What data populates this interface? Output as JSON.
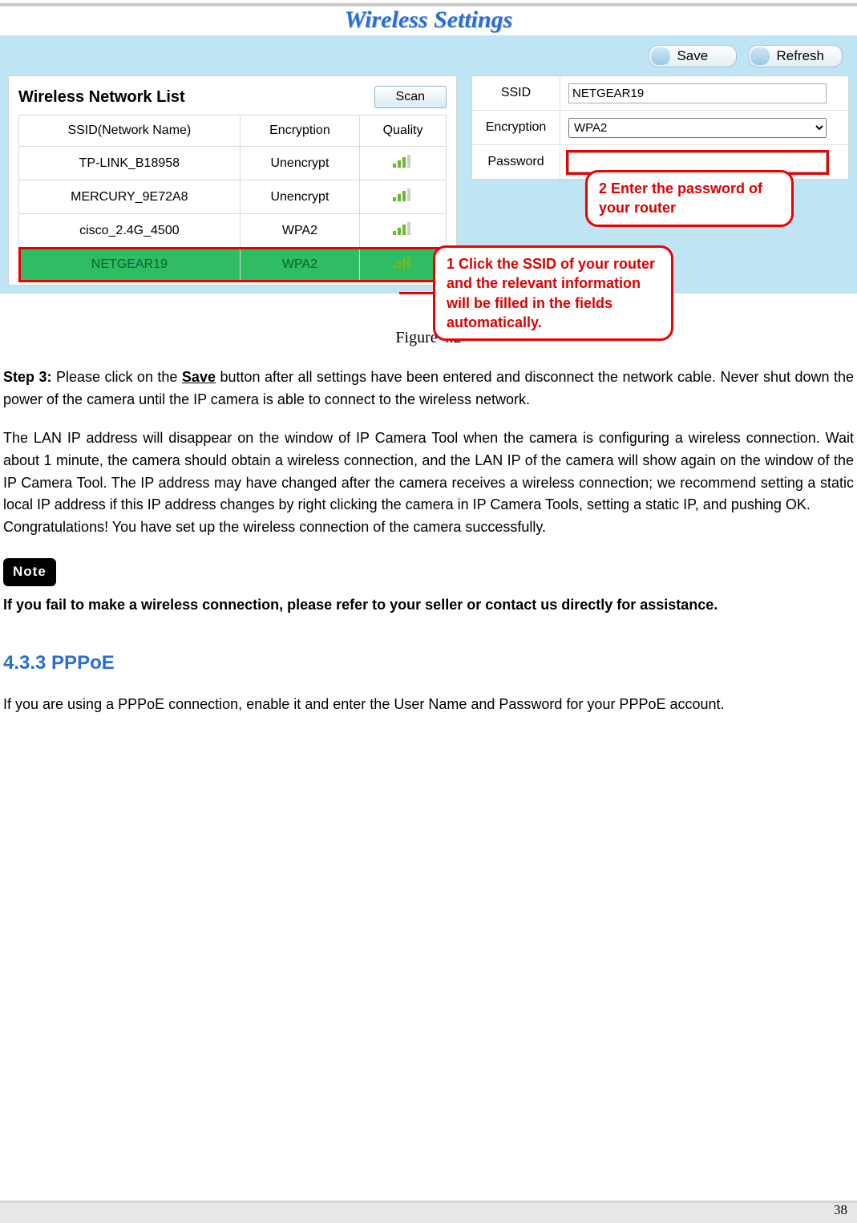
{
  "header": {
    "title": "Wireless Settings"
  },
  "buttons": {
    "save": "Save",
    "refresh": "Refresh",
    "scan": "Scan"
  },
  "netlist": {
    "title": "Wireless Network List",
    "cols": [
      "SSID(Network Name)",
      "Encryption",
      "Quality"
    ],
    "rows": [
      {
        "ssid": "TP-LINK_B18958",
        "enc": "Unencrypt",
        "quality": 3,
        "sel": false
      },
      {
        "ssid": "MERCURY_9E72A8",
        "enc": "Unencrypt",
        "quality": 3,
        "sel": false
      },
      {
        "ssid": "cisco_2.4G_4500",
        "enc": "WPA2",
        "quality": 3,
        "sel": false
      },
      {
        "ssid": "NETGEAR19",
        "enc": "WPA2",
        "quality": 4,
        "sel": true
      }
    ]
  },
  "fields": {
    "ssid_label": "SSID",
    "ssid_value": "NETGEAR19",
    "enc_label": "Encryption",
    "enc_value": "WPA2",
    "pwd_label": "Password",
    "pwd_value": ""
  },
  "callouts": {
    "c1": "1 Click the SSID of your router and the relevant information will be filled in the fields automatically.",
    "c2": "2 Enter the password of your router"
  },
  "figure_caption": "Figure 4.2",
  "body": {
    "step3_label": "Step 3:",
    "save_word": "Save",
    "p1a": " Please click on the ",
    "p1b": " button after all settings have been entered and disconnect the network cable. Never shut down the power of the camera until the IP camera is able to connect to the wireless network.",
    "p2": "The LAN IP address will disappear on the window of IP Camera Tool when the camera is configuring a wireless connection. Wait about 1 minute, the camera should obtain a wireless connection, and the LAN IP of the camera will show again on the window of the IP Camera Tool. The IP address may have changed after the camera receives a wireless connection; we recommend setting a static local IP address if this IP address changes by right clicking the camera in IP Camera Tools, setting a static IP, and pushing OK.",
    "p3": "Congratulations! You have set up the wireless connection of the camera successfully.",
    "note_badge": "Note",
    "note_text": "If you fail to make a wireless connection, please refer to your seller or contact us directly for assistance.",
    "section_title": "4.3.3 PPPoE",
    "pppoe_text": "If you are using a PPPoE connection, enable it and enter the User Name and Password for your PPPoE account."
  },
  "page_number": "38"
}
